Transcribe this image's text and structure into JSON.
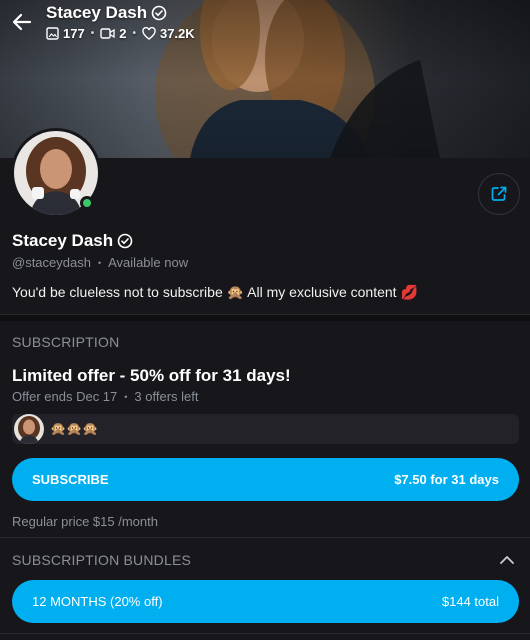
{
  "header": {
    "name": "Stacey Dash",
    "stats": {
      "photos": "177",
      "videos": "2",
      "likes": "37.2K"
    }
  },
  "profile": {
    "name": "Stacey Dash",
    "handle": "@staceydash",
    "status": "Available now",
    "bio": "You'd be clueless not to subscribe 🙊 All my exclusive content 💋"
  },
  "subscription": {
    "section_title": "SUBSCRIPTION",
    "offer_title": "Limited offer - 50% off for 31 days!",
    "offer_ends": "Offer ends Dec 17",
    "offers_left": "3 offers left",
    "message": "🙊🙊🙊",
    "button_label": "SUBSCRIBE",
    "button_price": "$7.50 for 31 days",
    "regular_price": "Regular price $15 /month"
  },
  "bundles": {
    "section_title": "SUBSCRIPTION BUNDLES",
    "items": [
      {
        "label": "12 MONTHS (20% off)",
        "price": "$144 total"
      }
    ]
  },
  "colors": {
    "accent": "#00aff0",
    "background": "#17171b",
    "online": "#3cc768",
    "muted": "#8a8f98"
  },
  "icons": [
    "back-arrow-icon",
    "verified-icon",
    "image-icon",
    "video-icon",
    "heart-icon",
    "share-icon",
    "chevron-up-icon"
  ]
}
